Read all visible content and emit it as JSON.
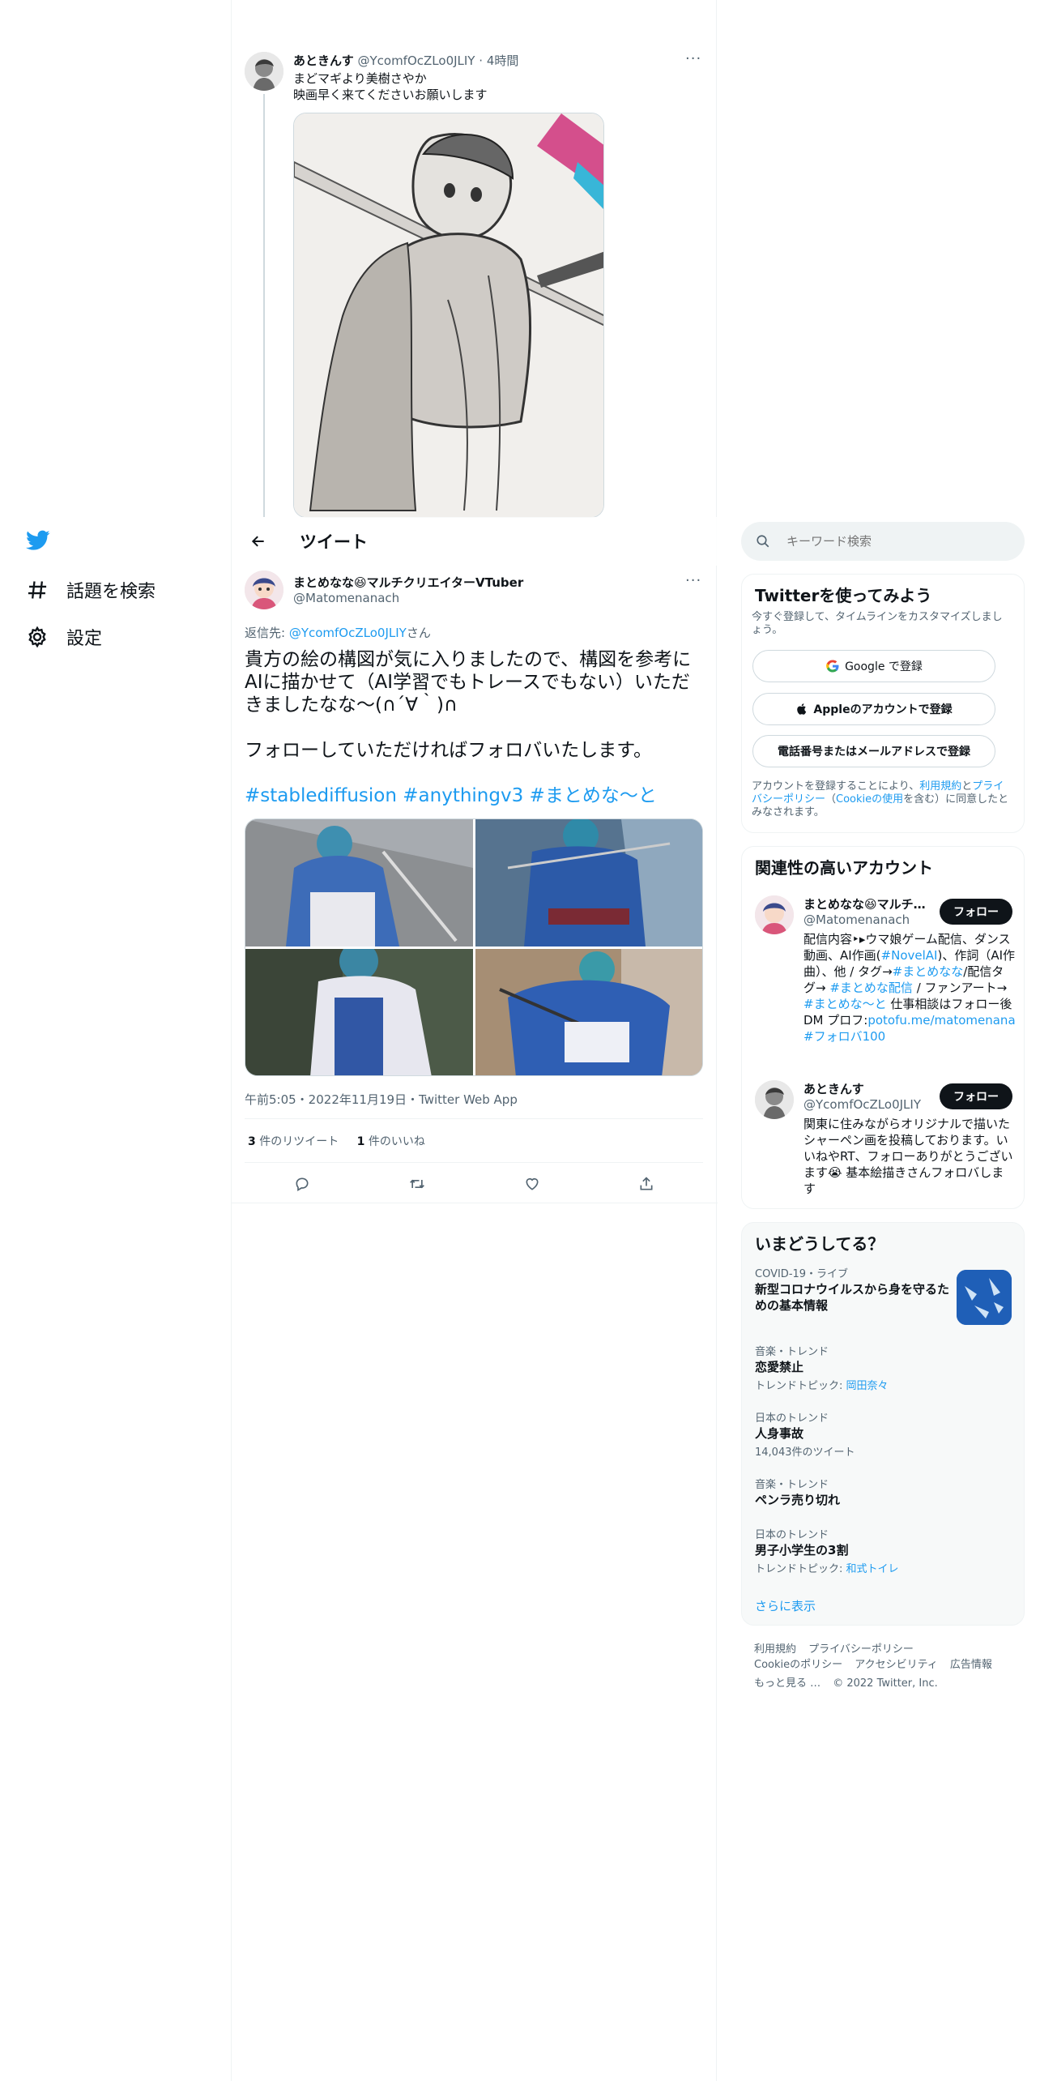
{
  "nav": {
    "explore_label": "話題を検索",
    "settings_label": "設定"
  },
  "parent_tweet": {
    "display_name": "あときんす",
    "handle": "@YcomfOcZLo0JLIY",
    "time": "4時間",
    "line1": "まどマギより美樹さやか",
    "line2": "映画早く来てくださいお願いします",
    "more": "···"
  },
  "header": {
    "title": "ツイート"
  },
  "main_tweet": {
    "display_name": "まとめなな😆マルチクリエイターVTuber",
    "handle": "@Matomenanach",
    "more": "···",
    "reply_prefix": "返信先: ",
    "reply_handle": "@YcomfOcZLo0JLIY",
    "reply_suffix": "さん",
    "body1": "貴方の絵の構図が気に入りましたので、構図を参考にAIに描かせて（AI学習でもトレースでもない）いただきましたなな～(∩´∀｀)∩",
    "body2": "フォローしていただければフォロバいたします。",
    "hashtag1": "#stablediffusion",
    "hashtag2": "#anythingv3",
    "hashtag3": "#まとめな～と",
    "timestamp": "午前5:05・2022年11月19日・Twitter Web App",
    "retweet_count": "3",
    "retweet_label": " 件のリツイート",
    "like_count": "1",
    "like_label": " 件のいいね"
  },
  "search": {
    "placeholder": "キーワード検索"
  },
  "signup": {
    "title": "Twitterを使ってみよう",
    "subtitle": "今すぐ登録して、タイムラインをカスタマイズしましょう。",
    "google_label": "Google で登録",
    "apple_label": "Appleのアカウントで登録",
    "phone_label": "電話番号またはメールアドレスで登録",
    "legal_1": "アカウントを登録することにより、",
    "legal_terms": "利用規約",
    "legal_2": "と",
    "legal_privacy": "プライバシーポリシー",
    "legal_3": "（",
    "legal_cookie": "Cookieの使用",
    "legal_4": "を含む）に同意したとみなされます。"
  },
  "related": {
    "title": "関連性の高いアカウント",
    "follow_label": "フォロー",
    "accounts": [
      {
        "display_name": "まとめなな😆マルチ…",
        "handle": "@Matomenanach",
        "bio_a": "配信内容‣▸ウマ娘ゲーム配信、ダンス動画、AI作画(",
        "bio_link1": "#NovelAI",
        "bio_b": ")、作詞（AI作曲）、他 / タグ→",
        "bio_link2": "#まとめなな",
        "bio_c": "/配信タグ→ ",
        "bio_link3": "#まとめな配信",
        "bio_d": " / ファンアート→ ",
        "bio_link4": "#まとめな～と",
        "bio_e": " 仕事相談はフォロー後DM プロフ:",
        "bio_link5": "potofu.me/matomenana",
        "bio_f": " ",
        "bio_link6": "#フォロバ100"
      },
      {
        "display_name": "あときんす",
        "handle": "@YcomfOcZLo0JLIY",
        "bio": "関東に住みながらオリジナルで描いたシャーペン画を投稿しております。いいねやRT、フォローありがとうございます😭 基本絵描きさんフォロバします"
      }
    ]
  },
  "trends": {
    "title": "いまどうしてる？",
    "items": [
      {
        "category": "COVID-19・ライブ",
        "name": "新型コロナウイルスから身を守るための基本情報",
        "meta": ""
      },
      {
        "category": "音楽・トレンド",
        "name": "恋愛禁止",
        "meta_prefix": "トレンドトピック: ",
        "meta_link": "岡田奈々"
      },
      {
        "category": "日本のトレンド",
        "name": "人身事故",
        "meta": "14,043件のツイート"
      },
      {
        "category": "音楽・トレンド",
        "name": "ペンラ売り切れ",
        "meta": ""
      },
      {
        "category": "日本のトレンド",
        "name": "男子小学生の3割",
        "meta_prefix": "トレンドトピック: ",
        "meta_link": "和式トイレ"
      }
    ],
    "show_more": "さらに表示"
  },
  "footer": {
    "terms": "利用規約",
    "privacy": "プライバシーポリシー",
    "cookie": "Cookieのポリシー",
    "accessibility": "アクセシビリティ",
    "ads": "広告情報",
    "more": "もっと見る …",
    "copyright": "© 2022 Twitter, Inc."
  },
  "colors": {
    "accent": "#1d9bf0",
    "text": "#0f1419",
    "muted": "#536471",
    "panel": "#f7f9f9"
  }
}
